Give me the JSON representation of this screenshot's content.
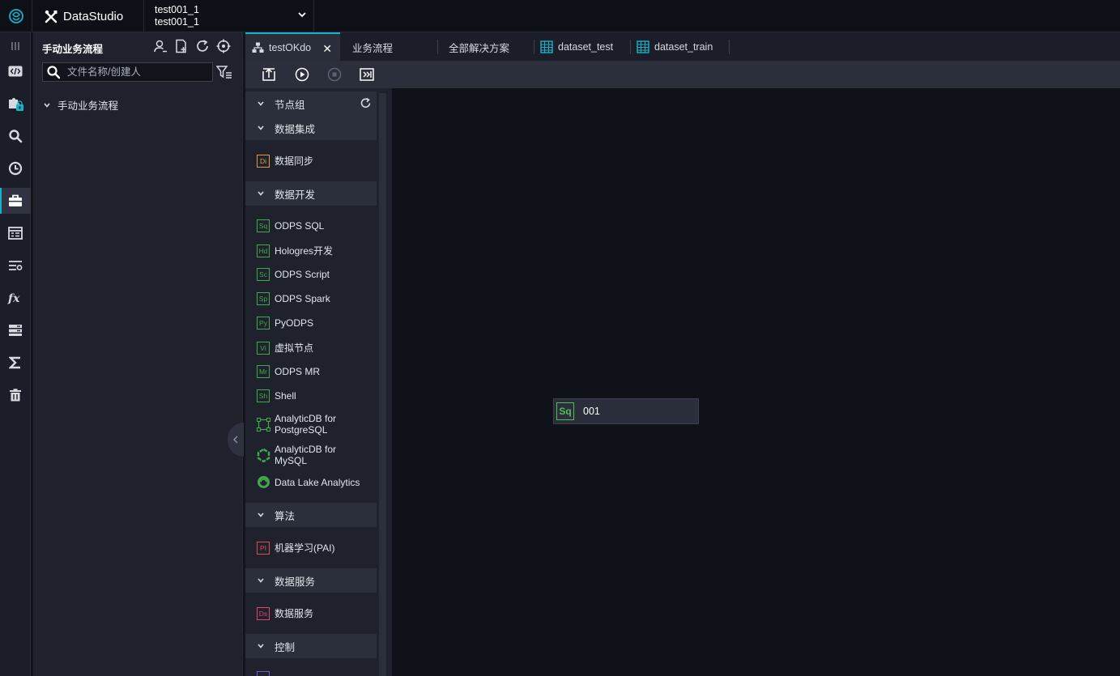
{
  "app": {
    "title": "DataStudio"
  },
  "project": {
    "line1": "test001_1",
    "line2": "test001_1"
  },
  "sidebar": {
    "title": "手动业务流程",
    "search_placeholder": "文件名称/创建人",
    "tree_root": "手动业务流程"
  },
  "tabs": [
    {
      "label": "testOKdo",
      "icon": "workflow-icon",
      "active": true
    },
    {
      "label": "业务流程",
      "icon": "",
      "active": false
    },
    {
      "label": "全部解决方案",
      "icon": "",
      "active": false
    },
    {
      "label": "dataset_test",
      "icon": "table-icon",
      "active": false
    },
    {
      "label": "dataset_train",
      "icon": "table-icon",
      "active": false
    }
  ],
  "palette": {
    "groups": {
      "node_group": "节点组",
      "integration": "数据集成",
      "development": "数据开发",
      "algorithm": "算法",
      "service": "数据服务",
      "control": "控制"
    },
    "integration_items": [
      {
        "badge": "Di",
        "label": "数据同步"
      }
    ],
    "development_items": [
      {
        "badge": "Sq",
        "label": "ODPS SQL"
      },
      {
        "badge": "Hd",
        "label": "Hologres开发"
      },
      {
        "badge": "Sc",
        "label": "ODPS Script"
      },
      {
        "badge": "Sp",
        "label": "ODPS Spark"
      },
      {
        "badge": "Py",
        "label": "PyODPS"
      },
      {
        "badge": "Vi",
        "label": "虚拟节点"
      },
      {
        "badge": "Mr",
        "label": "ODPS MR"
      },
      {
        "badge": "Sh",
        "label": "Shell"
      }
    ],
    "adb_pg": {
      "line1": "AnalyticDB for",
      "line2": "PostgreSQL"
    },
    "adb_mysql": {
      "line1": "AnalyticDB for",
      "line2": "MySQL"
    },
    "dla": {
      "label": "Data Lake Analytics"
    },
    "algorithm_items": [
      {
        "badge": "PI",
        "label": "机器学习(PAI)"
      }
    ],
    "service_items": [
      {
        "badge": "Ds",
        "label": "数据服务"
      }
    ]
  },
  "canvas": {
    "node": {
      "badge": "Sq",
      "label": "001"
    }
  },
  "colors": {
    "accent": "#16b3c8",
    "green": "#3faa4c"
  }
}
